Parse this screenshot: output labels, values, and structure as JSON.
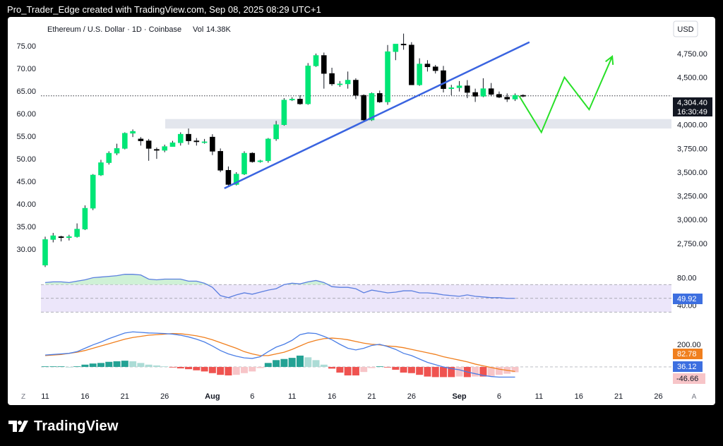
{
  "topbar": {
    "text": "Pro_Trader_Edge created with TradingView.com, Sep 08, 2025 08:29 UTC+1"
  },
  "brand": {
    "logo_label": "TradingView",
    "logo_icon": "tradingview-logo-icon"
  },
  "chart_data": [
    {
      "type": "candlestick",
      "title": "Ethereum / U.S. Dollar · 1D · Coinbase",
      "volume_label": "Vol",
      "volume_value": "14.38K",
      "currency": "USD",
      "left_axis_ticks": [
        "75.00",
        "70.00",
        "65.00",
        "60.00",
        "55.00",
        "50.00",
        "45.00",
        "40.00",
        "35.00",
        "30.00"
      ],
      "left_axis_range": [
        27.5,
        77.5
      ],
      "right_axis_ticks": [
        "4,750.00",
        "4,500.00",
        "4,000.00",
        "3,750.00",
        "3,500.00",
        "3,250.00",
        "3,000.00",
        "2,750.00"
      ],
      "right_axis_values": [
        4750,
        4500,
        4000,
        3750,
        3500,
        3250,
        3000,
        2750
      ],
      "right_axis_range": [
        2570,
        4950
      ],
      "x_ticks": [
        {
          "i": 0,
          "label": "11"
        },
        {
          "i": 5,
          "label": "16"
        },
        {
          "i": 10,
          "label": "21"
        },
        {
          "i": 15,
          "label": "26"
        },
        {
          "i": 21,
          "label": "Aug"
        },
        {
          "i": 26,
          "label": "6"
        },
        {
          "i": 31,
          "label": "11"
        },
        {
          "i": 36,
          "label": "16"
        },
        {
          "i": 41,
          "label": "21"
        },
        {
          "i": 46,
          "label": "26"
        },
        {
          "i": 52,
          "label": "Sep"
        },
        {
          "i": 57,
          "label": "6"
        },
        {
          "i": 62,
          "label": "11"
        },
        {
          "i": 67,
          "label": "16"
        },
        {
          "i": 72,
          "label": "21"
        },
        {
          "i": 77,
          "label": "26"
        }
      ],
      "left_corner": "Z",
      "right_corner": "A",
      "last_price": "4,304.40",
      "countdown": "16:30:49",
      "current_price": 4304.4,
      "candles": [
        [
          2520,
          2790,
          2500,
          2820
        ],
        [
          2790,
          2830,
          2760,
          2860
        ],
        [
          2820,
          2810,
          2770,
          2830
        ],
        [
          2810,
          2820,
          2780,
          2840
        ],
        [
          2820,
          2900,
          2810,
          2960
        ],
        [
          2900,
          3120,
          2890,
          3150
        ],
        [
          3120,
          3470,
          3100,
          3480
        ],
        [
          3470,
          3600,
          3460,
          3630
        ],
        [
          3600,
          3700,
          3580,
          3720
        ],
        [
          3700,
          3750,
          3680,
          3800
        ],
        [
          3750,
          3910,
          3740,
          3920
        ],
        [
          3910,
          3930,
          3870,
          3950
        ],
        [
          3850,
          3830,
          3780,
          3870
        ],
        [
          3830,
          3750,
          3620,
          3850
        ],
        [
          3740,
          3730,
          3640,
          3760
        ],
        [
          3730,
          3770,
          3710,
          3790
        ],
        [
          3770,
          3810,
          3770,
          3830
        ],
        [
          3810,
          3900,
          3780,
          3920
        ],
        [
          3900,
          3830,
          3790,
          3960
        ],
        [
          3830,
          3820,
          3780,
          3860
        ],
        [
          3820,
          3820,
          3800,
          3850
        ],
        [
          3870,
          3720,
          3680,
          3900
        ],
        [
          3720,
          3520,
          3500,
          3750
        ],
        [
          3520,
          3370,
          3360,
          3560
        ],
        [
          3370,
          3480,
          3360,
          3500
        ],
        [
          3480,
          3700,
          3470,
          3720
        ],
        [
          3700,
          3610,
          3600,
          3710
        ],
        [
          3610,
          3620,
          3600,
          3630
        ],
        [
          3620,
          3850,
          3600,
          3860
        ],
        [
          3850,
          4000,
          3830,
          4040
        ],
        [
          4000,
          4260,
          3990,
          4280
        ],
        [
          4260,
          4270,
          4250,
          4290
        ],
        [
          4270,
          4220,
          4210,
          4310
        ],
        [
          4220,
          4620,
          4210,
          4650
        ],
        [
          4620,
          4730,
          4610,
          4750
        ],
        [
          4730,
          4540,
          4380,
          4760
        ],
        [
          4540,
          4430,
          4410,
          4600
        ],
        [
          4430,
          4430,
          4400,
          4460
        ],
        [
          4430,
          4470,
          4380,
          4560
        ],
        [
          4470,
          4310,
          4270,
          4490
        ],
        [
          4310,
          4050,
          4040,
          4320
        ],
        [
          4050,
          4330,
          4040,
          4340
        ],
        [
          4330,
          4240,
          4230,
          4360
        ],
        [
          4240,
          4770,
          4210,
          4840
        ],
        [
          4770,
          4850,
          4680,
          4850
        ],
        [
          4850,
          4840,
          4790,
          4960
        ],
        [
          4840,
          4420,
          4420,
          4870
        ],
        [
          4420,
          4640,
          4410,
          4700
        ],
        [
          4640,
          4610,
          4560,
          4680
        ],
        [
          4610,
          4570,
          4540,
          4630
        ],
        [
          4570,
          4380,
          4340,
          4620
        ],
        [
          4380,
          4390,
          4310,
          4420
        ],
        [
          4390,
          4410,
          4350,
          4460
        ],
        [
          4410,
          4340,
          4280,
          4470
        ],
        [
          4340,
          4300,
          4240,
          4380
        ],
        [
          4300,
          4380,
          4290,
          4490
        ],
        [
          4380,
          4320,
          4300,
          4440
        ],
        [
          4320,
          4290,
          4280,
          4350
        ],
        [
          4290,
          4270,
          4240,
          4330
        ],
        [
          4270,
          4310,
          4250,
          4330
        ],
        [
          4310,
          4300,
          4290,
          4320
        ]
      ],
      "support_zone": [
        3960,
        4060
      ],
      "trendline": {
        "from": [
          22.5,
          3330
        ],
        "to": [
          60.8,
          4870
        ]
      },
      "projection": [
        [
          59.5,
          4305
        ],
        [
          62.3,
          3920
        ],
        [
          65.2,
          4500
        ],
        [
          68.3,
          4160
        ],
        [
          71.2,
          4720
        ]
      ]
    },
    {
      "type": "line",
      "name": "RSI",
      "ticks": [
        "80.00",
        "40.00"
      ],
      "tick_values": [
        80,
        40
      ],
      "band": [
        30,
        70
      ],
      "midline": 50,
      "current_label": "49.92",
      "ylim": [
        20,
        98
      ],
      "values": [
        73,
        74,
        74,
        73,
        75,
        77,
        80,
        81,
        82,
        83,
        85,
        85,
        84,
        78,
        77,
        78,
        78,
        78,
        75,
        75,
        72,
        66,
        54,
        51,
        55,
        58,
        56,
        59,
        62,
        64,
        70,
        72,
        71,
        74,
        76,
        73,
        67,
        66,
        66,
        64,
        58,
        62,
        60,
        58,
        59,
        61,
        61,
        58,
        58,
        57,
        55,
        54,
        53,
        55,
        53,
        52,
        51,
        51,
        50,
        50
      ]
    },
    {
      "type": "macd",
      "name": "MACD",
      "tick": "200.00",
      "tick_value": 200,
      "macd_label": "36.12",
      "signal_label": "82.78",
      "hist_label": "-46.66",
      "ylim": [
        -150,
        380
      ],
      "macd": [
        105,
        110,
        115,
        120,
        135,
        165,
        195,
        220,
        250,
        275,
        300,
        310,
        305,
        300,
        298,
        295,
        290,
        280,
        265,
        245,
        220,
        185,
        145,
        115,
        95,
        80,
        75,
        90,
        135,
        175,
        200,
        235,
        285,
        300,
        295,
        270,
        240,
        200,
        165,
        150,
        165,
        190,
        200,
        180,
        155,
        120,
        100,
        70,
        40,
        20,
        0,
        -15,
        -25,
        -45,
        -60,
        -75,
        -85,
        -90,
        -90,
        -90
      ],
      "signal": [
        100,
        105,
        110,
        120,
        130,
        145,
        165,
        185,
        205,
        225,
        245,
        260,
        270,
        280,
        285,
        290,
        295,
        293,
        285,
        275,
        260,
        240,
        215,
        190,
        165,
        135,
        115,
        100,
        100,
        115,
        130,
        155,
        185,
        215,
        235,
        250,
        255,
        250,
        240,
        225,
        210,
        200,
        195,
        185,
        180,
        170,
        155,
        140,
        125,
        110,
        90,
        75,
        60,
        45,
        25,
        10,
        -5,
        -20,
        -30,
        -40
      ],
      "hist": [
        5,
        5,
        5,
        0,
        5,
        20,
        30,
        35,
        45,
        50,
        55,
        50,
        35,
        20,
        13,
        5,
        -5,
        -13,
        -20,
        -30,
        -40,
        -55,
        -70,
        -75,
        -70,
        -55,
        -40,
        -10,
        35,
        60,
        70,
        80,
        100,
        85,
        60,
        20,
        -15,
        -50,
        -75,
        -75,
        -45,
        -10,
        5,
        -5,
        -25,
        -50,
        -55,
        -70,
        -85,
        -90,
        -90,
        -90,
        -85,
        -90,
        -85,
        -85,
        -80,
        -70,
        -60,
        -47
      ]
    }
  ],
  "colors": {
    "up": "#00e676",
    "down": "#000000",
    "trend": "#3a64e0",
    "projection": "#28e028",
    "rsi": "#5b7fe0",
    "rsi_band": "#ece6fa",
    "macd": "#4a7ee6",
    "signal": "#f07f1e",
    "hist_up_strong": "#23a294",
    "hist_up_weak": "#acdcd6",
    "hist_down_strong": "#ef5350",
    "hist_down_weak": "#f7c5c8"
  }
}
